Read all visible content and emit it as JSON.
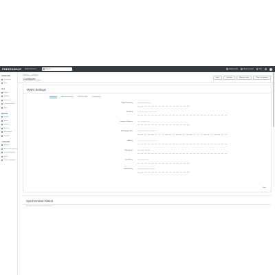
{
  "topbar": {
    "logo": "PRESTASHOP",
    "quick_access": "Quick Access ▾",
    "search_placeholder": "Search",
    "links": [
      "Debug mode",
      "View my shop",
      "Help"
    ],
    "icons": [
      "bug-icon",
      "eye-icon",
      "bell-icon",
      "avatar"
    ]
  },
  "sidebar": {
    "sections": [
      {
        "title": "DASHBOARD",
        "items": [
          {
            "label": "Dashboard",
            "icon": "trend-icon"
          },
          {
            "label": "Stats",
            "icon": "chart-icon"
          }
        ]
      },
      {
        "title": "SELL",
        "items": [
          {
            "label": "Orders",
            "icon": "cart-icon"
          },
          {
            "label": "Catalog",
            "icon": "store-icon"
          },
          {
            "label": "Customers",
            "icon": "person-icon"
          },
          {
            "label": "Customer Service",
            "icon": "chat-icon"
          },
          {
            "label": "Stats",
            "icon": "chart-icon"
          }
        ]
      },
      {
        "title": "IMPROVE",
        "items": [
          {
            "label": "Modules",
            "icon": "puzzle-icon",
            "active": true
          },
          {
            "label": "Design",
            "icon": "brush-icon"
          },
          {
            "label": "Shipping",
            "icon": "truck-icon"
          },
          {
            "label": "Payment",
            "icon": "card-icon"
          },
          {
            "label": "International",
            "icon": "globe-icon"
          },
          {
            "label": "Template",
            "icon": "layout-icon"
          }
        ]
      },
      {
        "title": "CONFIGURE",
        "items": [
          {
            "label": "Settings",
            "icon": "gear-icon"
          },
          {
            "label": "Advanced Parameters",
            "icon": "settings-icon"
          },
          {
            "label": "Transit Information",
            "icon": "info-icon"
          },
          {
            "label": "Return",
            "icon": "return-icon"
          },
          {
            "label": "Custom Integration",
            "icon": "link-icon"
          }
        ]
      }
    ]
  },
  "header": {
    "breadcrumb": "Modules › Configure",
    "title": "Configure",
    "subtitle": "Easy payments with Mykro",
    "buttons": [
      "Back",
      "Translate",
      "Manage hooks",
      "Check for updates"
    ]
  },
  "settings": {
    "title": "Mykro Settings",
    "tabs": [
      {
        "label": "Credentials",
        "active": true
      },
      {
        "label": "Advanced Settings"
      },
      {
        "label": "Stock & Order"
      },
      {
        "label": "Configurations"
      }
    ],
    "fields": [
      {
        "label": "Mykro Username",
        "value": "mykro@prestashop"
      },
      {
        "label": "Password",
        "value": "•••••••••••••••••••••••••••••••••••••"
      },
      {
        "label": "Customer Reference",
        "value": "ref_customer_001"
      },
      {
        "label": "API Endpoint URL",
        "value": "https://api.mykro.example/v1"
      },
      {
        "label": "API Key",
        "value": "•••••••••••••••••••••••••••••••••••••"
      },
      {
        "label": "Merchant ID",
        "value": "merchant_0000000"
      },
      {
        "label": "Shop Name",
        "value": "prestashop-shop"
      },
      {
        "label": "Shop Domain",
        "value": "shop.prestashop.example"
      }
    ],
    "save_label": "Save"
  },
  "orders": {
    "title": "Synchronized Orders",
    "subtitle": "No orders have been synchronized yet."
  }
}
